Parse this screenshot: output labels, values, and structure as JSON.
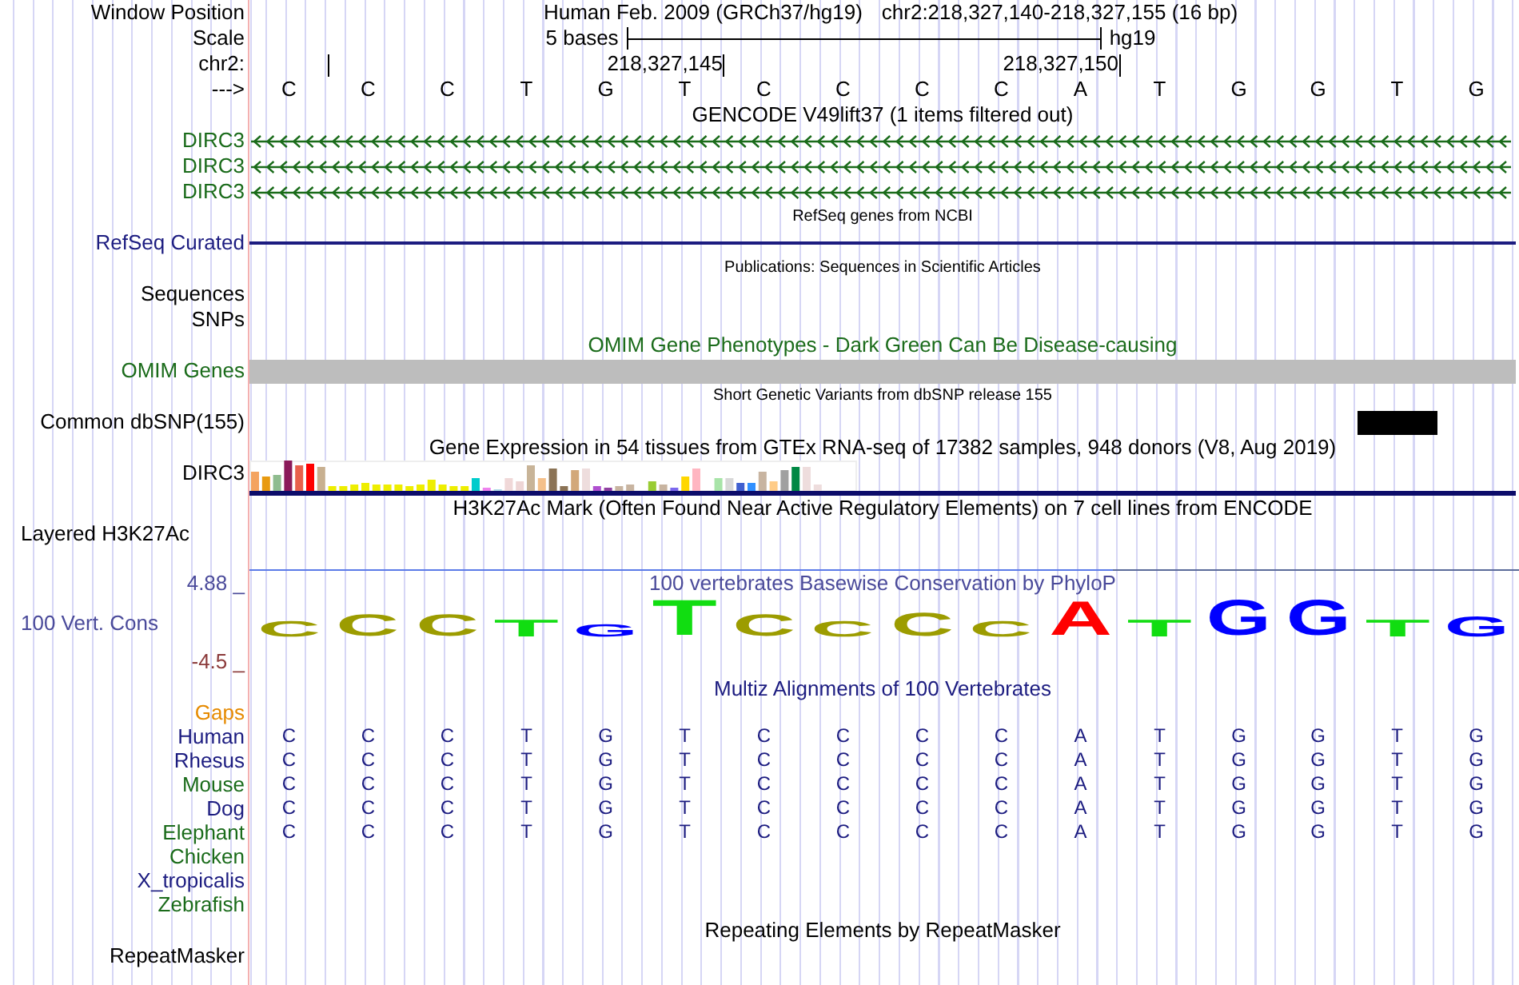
{
  "header": {
    "label": "Window Position",
    "title": "Human Feb. 2009 (GRCh37/hg19)",
    "position": "chr2:218,327,140-218,327,155 (16 bp)"
  },
  "scale": {
    "label": "Scale",
    "span": "5 bases",
    "assembly": "hg19"
  },
  "coordinates": {
    "label": "chr2:",
    "ticks": [
      "218,327,145",
      "218,327,150"
    ]
  },
  "sequence": {
    "label": "--->",
    "bases": [
      "C",
      "C",
      "C",
      "T",
      "G",
      "T",
      "C",
      "C",
      "C",
      "C",
      "A",
      "T",
      "G",
      "G",
      "T",
      "G"
    ]
  },
  "tracks": [
    {
      "rows": [
        {
          "kind": "title",
          "text": "GENCODE V49lift37 (1 items filtered out)",
          "small": false,
          "color": "#000000"
        },
        {
          "kind": "arrows",
          "label": "DIRC3",
          "color": "#1a6b1a"
        },
        {
          "kind": "arrows",
          "label": "DIRC3",
          "color": "#1a6b1a"
        },
        {
          "kind": "arrows",
          "label": "DIRC3",
          "color": "#1a6b1a"
        }
      ]
    },
    {
      "rows": [
        {
          "kind": "title",
          "text": "RefSeq genes from NCBI",
          "small": true,
          "color": "#000000"
        },
        {
          "kind": "line",
          "label": "RefSeq Curated",
          "color": "#1c1c80"
        }
      ]
    },
    {
      "rows": [
        {
          "kind": "title",
          "text": "Publications: Sequences in Scientific Articles",
          "small": true,
          "color": "#000000"
        },
        {
          "kind": "empty",
          "label": "Sequences",
          "color": "#000000"
        },
        {
          "kind": "empty",
          "label": "SNPs",
          "color": "#000000"
        }
      ]
    },
    {
      "rows": [
        {
          "kind": "title",
          "text": "OMIM Gene Phenotypes - Dark Green Can Be Disease-causing",
          "small": false,
          "color": "#1a6b1a"
        },
        {
          "kind": "bar",
          "label": "OMIM Genes",
          "color": "#1a6b1a"
        }
      ]
    },
    {
      "rows": [
        {
          "kind": "title",
          "text": "Short Genetic Variants from dbSNP release 155",
          "small": true,
          "color": "#000000"
        },
        {
          "kind": "variant",
          "label": "Common dbSNP(155)",
          "color": "#000000"
        }
      ]
    },
    {
      "rows": [
        {
          "kind": "title",
          "text": "Gene Expression in 54 tissues from GTEx RNA-seq of 17382 samples, 948 donors (V8, Aug 2019)",
          "small": false,
          "color": "#000000"
        },
        {
          "kind": "expression",
          "label": "DIRC3",
          "color": "#000000"
        }
      ]
    },
    {
      "rows": [
        {
          "kind": "title",
          "text": "H3K27Ac Mark (Often Found Near Active Regulatory Elements) on 7 cell lines from ENCODE",
          "small": false,
          "color": "#000000"
        },
        {
          "kind": "signal",
          "label": "Layered H3K27Ac",
          "color": "#000000"
        }
      ]
    },
    {
      "rows": [
        {
          "kind": "title",
          "label": "4.88 _",
          "text": "100 vertebrates Basewise Conservation by PhyloP",
          "small": false,
          "color": "#4a4a9a"
        },
        {
          "kind": "logo",
          "label": "100 Vert. Cons",
          "color": "#4a4a9a",
          "letters": [
            {
              "base": "C",
              "color": "#9c9c00"
            },
            {
              "base": "C",
              "color": "#9c9c00"
            },
            {
              "base": "C",
              "color": "#9c9c00"
            },
            {
              "base": "T",
              "color": "#11dd11"
            },
            {
              "base": "G",
              "color": "#0000ff"
            },
            {
              "base": "T",
              "color": "#11dd11"
            },
            {
              "base": "C",
              "color": "#9c9c00"
            },
            {
              "base": "C",
              "color": "#9c9c00"
            },
            {
              "base": "C",
              "color": "#9c9c00"
            },
            {
              "base": "C",
              "color": "#9c9c00"
            },
            {
              "base": "A",
              "color": "#ff0000"
            },
            {
              "base": "T",
              "color": "#11dd11"
            },
            {
              "base": "G",
              "color": "#0000ff"
            },
            {
              "base": "G",
              "color": "#0000ff"
            },
            {
              "base": "T",
              "color": "#11dd11"
            },
            {
              "base": "G",
              "color": "#0000ff"
            }
          ]
        },
        {
          "kind": "axis",
          "label": "-4.5 _",
          "color": "#8b3a3a"
        }
      ]
    },
    {
      "rows": [
        {
          "kind": "title",
          "text": "Multiz Alignments of 100 Vertebrates",
          "small": false,
          "color": "#1c1c80"
        },
        {
          "kind": "empty",
          "label": "Gaps",
          "color": "#e68a00"
        },
        {
          "kind": "alignment",
          "label": "Human",
          "color": "#1c1c80",
          "bases": [
            "C",
            "C",
            "C",
            "T",
            "G",
            "T",
            "C",
            "C",
            "C",
            "C",
            "A",
            "T",
            "G",
            "G",
            "T",
            "G"
          ]
        },
        {
          "kind": "alignment",
          "label": "Rhesus",
          "color": "#1c1c80",
          "bases": [
            "C",
            "C",
            "C",
            "T",
            "G",
            "T",
            "C",
            "C",
            "C",
            "C",
            "A",
            "T",
            "G",
            "G",
            "T",
            "G"
          ]
        },
        {
          "kind": "alignment",
          "label": "Mouse",
          "color": "#1a6b1a",
          "bases": [
            "C",
            "C",
            "C",
            "T",
            "G",
            "T",
            "C",
            "C",
            "C",
            "C",
            "A",
            "T",
            "G",
            "G",
            "T",
            "G"
          ]
        },
        {
          "kind": "alignment",
          "label": "Dog",
          "color": "#1c1c80",
          "bases": [
            "C",
            "C",
            "C",
            "T",
            "G",
            "T",
            "C",
            "C",
            "C",
            "C",
            "A",
            "T",
            "G",
            "G",
            "T",
            "G"
          ]
        },
        {
          "kind": "alignment",
          "label": "Elephant",
          "color": "#1a6b1a",
          "bases": [
            "C",
            "C",
            "C",
            "T",
            "G",
            "T",
            "C",
            "C",
            "C",
            "C",
            "A",
            "T",
            "G",
            "G",
            "T",
            "G"
          ]
        },
        {
          "kind": "alignment",
          "label": "Chicken",
          "color": "#1a6b1a"
        },
        {
          "kind": "alignment",
          "label": "X_tropicalis",
          "color": "#1c1c80"
        },
        {
          "kind": "alignment",
          "label": "Zebrafish",
          "color": "#1a6b1a"
        }
      ]
    },
    {
      "rows": [
        {
          "kind": "title",
          "text": "Repeating Elements by RepeatMasker",
          "small": false,
          "color": "#000000"
        },
        {
          "kind": "empty",
          "label": "RepeatMasker",
          "color": "#000000"
        }
      ]
    }
  ]
}
